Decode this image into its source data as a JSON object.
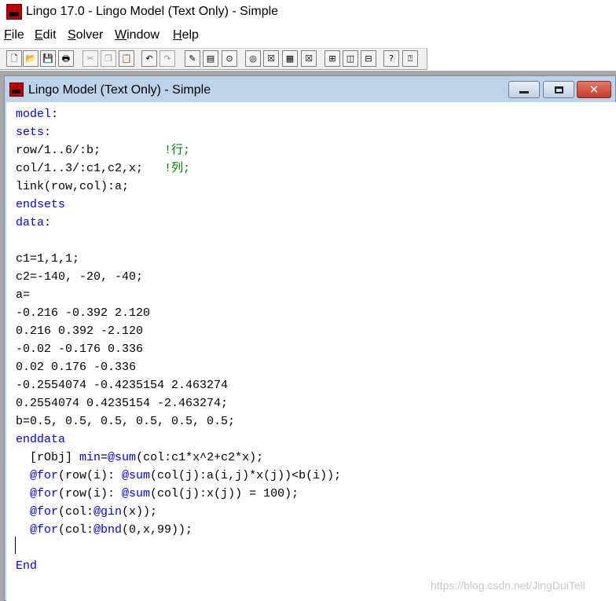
{
  "app": {
    "title": "Lingo 17.0 - Lingo Model (Text Only) - Simple"
  },
  "menu": [
    {
      "first": "F",
      "rest": "ile"
    },
    {
      "first": "E",
      "rest": "dit"
    },
    {
      "first": "S",
      "rest": "olver"
    },
    {
      "first": "W",
      "rest": "indow"
    },
    {
      "first": "H",
      "rest": "elp"
    }
  ],
  "toolbar": {
    "icons": [
      "new-file-icon",
      "open-folder-icon",
      "save-icon",
      "print-icon",
      "cut-icon",
      "copy-icon",
      "paste-icon",
      "undo-icon",
      "redo-icon",
      "find-icon",
      "find-next-icon",
      "match-parenthesis-icon",
      "solve-icon",
      "close-solution-icon",
      "send-to-back-icon",
      "options-icon",
      "tile-icon",
      "cascade-icon",
      "arrange-icon",
      "help-icon",
      "context-help-icon"
    ],
    "glyphs": [
      "🗋",
      "📂",
      "💾",
      "🖶",
      "✂",
      "❐",
      "📋",
      "↶",
      "↷",
      "✎",
      "▤",
      "⊙",
      "◎",
      "☒",
      "▦",
      "☒",
      "⊞",
      "◫",
      "⊟",
      "?",
      "⍰"
    ]
  },
  "child": {
    "title": "Lingo Model (Text Only) - Simple"
  },
  "code": [
    {
      "k": "model",
      "t": ":"
    },
    {
      "k": "sets",
      "t": ":"
    },
    {
      "t": "row/1..6/:b;         ",
      "c": "!行;"
    },
    {
      "t": "col/1..3/:c1,c2,x;   ",
      "c": "!列;"
    },
    {
      "t": "link(row,col):a;"
    },
    {
      "k": "endsets"
    },
    {
      "k": "data",
      "t": ":"
    },
    {
      "t": ""
    },
    {
      "t": "c1=1,1,1;"
    },
    {
      "t": "c2=-140, -20, -40;"
    },
    {
      "t": "a="
    },
    {
      "t": "-0.216 -0.392 2.120"
    },
    {
      "t": "0.216 0.392 -2.120"
    },
    {
      "t": "-0.02 -0.176 0.336"
    },
    {
      "t": "0.02 0.176 -0.336"
    },
    {
      "t": "-0.2554074 -0.4235154 2.463274"
    },
    {
      "t": "0.2554074 0.4235154 -2.463274;"
    },
    {
      "t": "b=0.5, 0.5, 0.5, 0.5, 0.5, 0.5;"
    },
    {
      "k": "enddata"
    },
    {
      "t": "  [rObj] ",
      "k": "min",
      "t2": "=",
      "k2": "@sum",
      "t3": "(col:c1*x^2+c2*x);"
    },
    {
      "k": "  @for",
      "t": "(row(i): ",
      "k2": "@sum",
      "t3": "(col(j):a(i,j)*x(j))<b(i));"
    },
    {
      "k": "  @for",
      "t": "(row(i): ",
      "k2": "@sum",
      "t3": "(col(j):x(j)) = 100);"
    },
    {
      "k": "  @for",
      "t": "(col:",
      "k2": "@gin",
      "t3": "(x));"
    },
    {
      "k": "  @for",
      "t": "(col:",
      "k2": "@bnd",
      "t3": "(0,x,99));"
    },
    {
      "t": ""
    },
    {
      "k": "End"
    }
  ],
  "watermark": "https://blog.csdn.net/JingDuiTell"
}
